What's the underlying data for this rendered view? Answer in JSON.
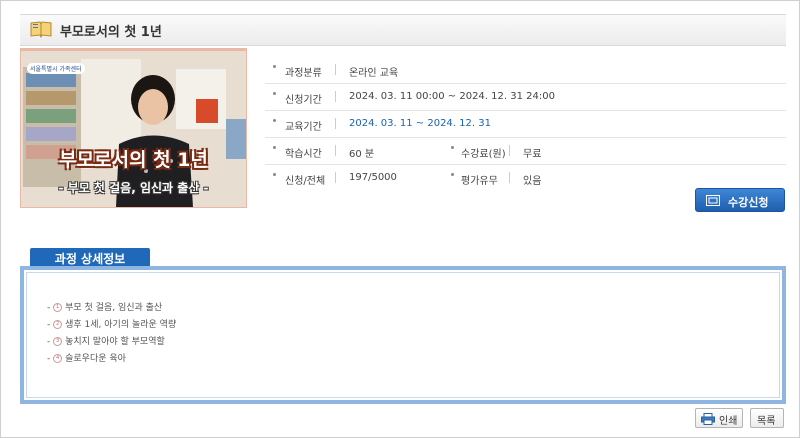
{
  "header": {
    "title": "부모로서의 첫 1년",
    "icon": "book-icon"
  },
  "thumbnail": {
    "logo_text": "서울특별시 가족센터",
    "title_text": "부모로서의 첫 1년",
    "subtitle_text": "- 부모 첫 걸음, 임신과 출산 -"
  },
  "info": {
    "category": {
      "label": "과정분류",
      "value": "온라인 교육"
    },
    "apply_period": {
      "label": "신청기간",
      "value": "2024. 03. 11 00:00 ~ 2024. 12. 31 24:00"
    },
    "edu_period": {
      "label": "교육기간",
      "value": "2024. 03. 11 ~ 2024. 12. 31"
    },
    "study_time": {
      "label": "학습시간",
      "value": "60 분"
    },
    "fee": {
      "label": "수강료(원)",
      "value": "무료"
    },
    "applicants": {
      "label": "신청/전체",
      "value": "197/5000"
    },
    "evaluation": {
      "label": "평가유무",
      "value": "있음"
    }
  },
  "apply_button": {
    "label": "수강신청",
    "icon": "apply-form-icon"
  },
  "detail": {
    "tab_label": "과정 상세정보",
    "items": [
      {
        "num": "1",
        "text": "부모 첫 걸음, 임신과 출산"
      },
      {
        "num": "2",
        "text": "생후 1세, 아기의 놀라운 역량"
      },
      {
        "num": "3",
        "text": "놓치지 말아야 할 부모역할"
      },
      {
        "num": "4",
        "text": "슬로우다운 육아"
      }
    ]
  },
  "footer": {
    "print_label": "인쇄",
    "print_icon": "printer-icon",
    "list_label": "목록"
  }
}
